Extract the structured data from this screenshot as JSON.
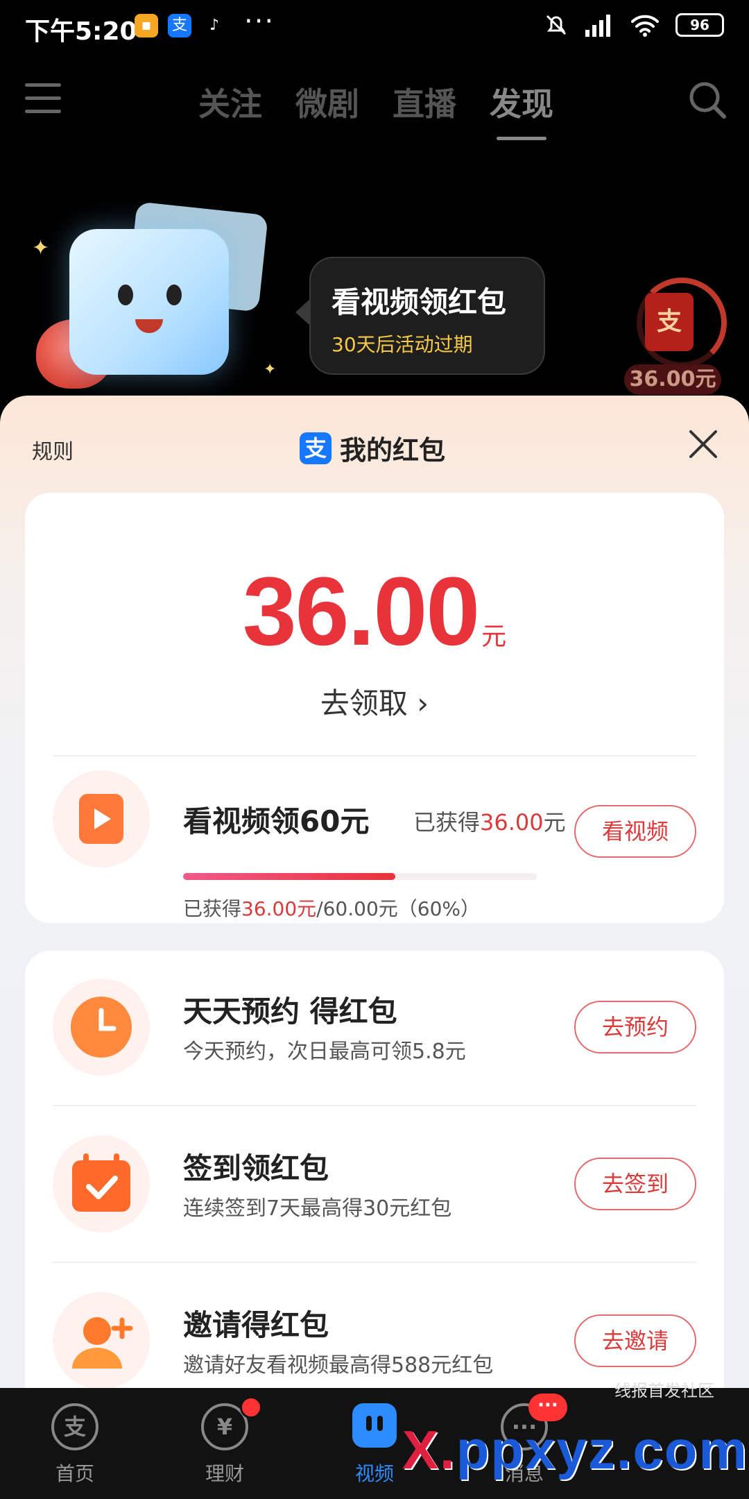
{
  "status_bar": {
    "time": "下午5:20",
    "battery": "96",
    "dots": "···",
    "app_icons": [
      "message-app-icon",
      "alipay-app-icon",
      "tiktok-app-icon"
    ]
  },
  "top_nav": {
    "tabs": [
      "关注",
      "微剧",
      "直播",
      "发现"
    ],
    "active_tab": "发现"
  },
  "promo": {
    "title": "看视频领红包",
    "subtitle": "30天后活动过期",
    "envelope_char": "支",
    "widget_amount": "36.00元"
  },
  "sheet": {
    "rules_label": "规则",
    "logo_char": "支",
    "title": "我的红包"
  },
  "balance": {
    "amount": "36.00",
    "unit": "元",
    "claim_label": "去领取 ›"
  },
  "video_task": {
    "title": "看视频领60元",
    "earned_prefix": "已获得",
    "earned_amount": "36.00",
    "earned_unit": "元",
    "progress_prefix": "已获得",
    "progress_current": "36.00元",
    "progress_total": "/60.00元（60%）",
    "progress_fraction": 0.6,
    "button_label": "看视频"
  },
  "tasks": [
    {
      "title": "天天预约 得红包",
      "subtitle": "今天预约，次日最高可领5.8元",
      "button_label": "去预约",
      "icon": "clock-icon"
    },
    {
      "title": "签到领红包",
      "subtitle": "连续签到7天最高得30元红包",
      "button_label": "去签到",
      "icon": "calendar-check-icon"
    },
    {
      "title": "邀请得红包",
      "subtitle": "邀请好友看视频最高得588元红包",
      "button_label": "去邀请",
      "icon": "invite-user-icon"
    }
  ],
  "bottom_tabs": [
    {
      "label": "首页",
      "icon_char": "支"
    },
    {
      "label": "理财",
      "icon_char": "¥"
    },
    {
      "label": "视频",
      "icon_char": ""
    },
    {
      "label": "消息",
      "icon_char": "···"
    }
  ],
  "watermark": {
    "main_pre": "X.",
    "main": "ppxyz.com",
    "small": "线报首发社区"
  },
  "colors": {
    "accent_red": "#e8333a",
    "active_blue": "#2d8cff",
    "alipay_blue": "#1677ff"
  }
}
